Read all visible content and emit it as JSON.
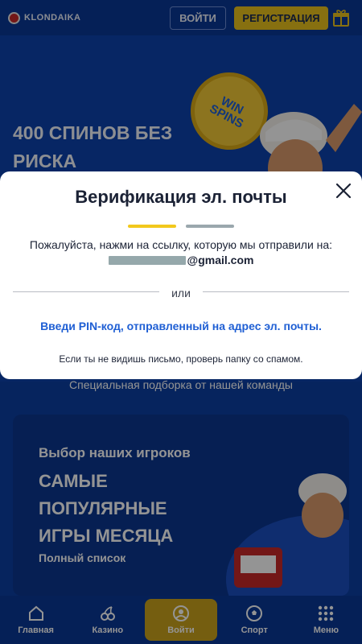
{
  "header": {
    "logo_text": "KLONDAIKA",
    "login_label": "ВОЙТИ",
    "register_label": "РЕГИСТРАЦИЯ",
    "gift_icon": "gift-icon"
  },
  "hero": {
    "coin_text": "WIN\nSPINS",
    "title": "400 СПИНОВ БЕЗ РИСКА"
  },
  "subtitle": "Специальная подборка от нашей команды",
  "promo": {
    "kicker": "Выбор наших игроков",
    "title": "САМЫЕ ПОПУЛЯРНЫЕ ИГРЫ МЕСЯЦА",
    "link": "Полный список"
  },
  "bottom_nav": {
    "items": [
      {
        "label": "Главная",
        "icon": "home-icon"
      },
      {
        "label": "Казино",
        "icon": "cherry-icon"
      },
      {
        "label": "Войти",
        "icon": "user-icon"
      },
      {
        "label": "Спорт",
        "icon": "ball-icon"
      },
      {
        "label": "Меню",
        "icon": "grid-icon"
      }
    ]
  },
  "modal": {
    "title": "Верификация эл. почты",
    "description": "Пожалуйста, нажми на ссылку, которую мы отправили на:",
    "email_domain": "@gmail.com",
    "divider_text": "или",
    "pin_link": "Введи PIN-код, отправленный на адрес эл. почты.",
    "spam_note": "Если ты не видишь письмо, проверь папку со спамом.",
    "close_icon": "close-icon"
  },
  "colors": {
    "brand_blue": "#0c3fa3",
    "accent_yellow": "#f2c81c",
    "link_blue": "#1f5fd4",
    "step_inactive": "#9aa7ad"
  }
}
